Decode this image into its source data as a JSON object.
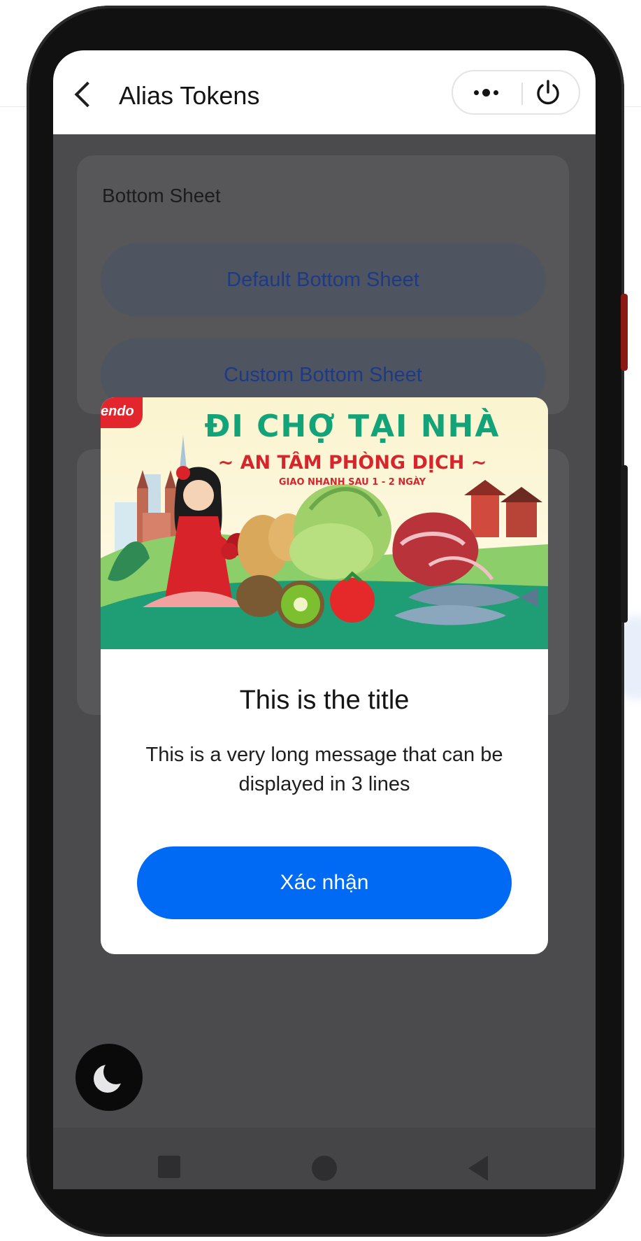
{
  "header": {
    "title": "Alias Tokens"
  },
  "page": {
    "section_title": "Bottom Sheet",
    "buttons": [
      {
        "label": "Default Bottom Sheet"
      },
      {
        "label": "Custom Bottom Sheet"
      }
    ]
  },
  "modal": {
    "banner": {
      "logo_text": "endo",
      "headline": "ĐI CHỢ TẠI NHÀ",
      "subheadline": "~ AN TÂM PHÒNG DỊCH ~",
      "tagline": "GIAO NHANH SAU 1 - 2 NGÀY"
    },
    "title": "This is the title",
    "message": "This is a very long message that can be displayed in 3 lines",
    "confirm_label": "Xác nhận"
  },
  "icons": {
    "back": "chevron-left-icon",
    "more": "more-dots-icon",
    "power": "power-icon",
    "theme": "moon-icon"
  },
  "colors": {
    "primary": "#006af5",
    "overlay": "#4b4b4d",
    "banner_green": "#12a378",
    "banner_red": "#d6262c"
  }
}
